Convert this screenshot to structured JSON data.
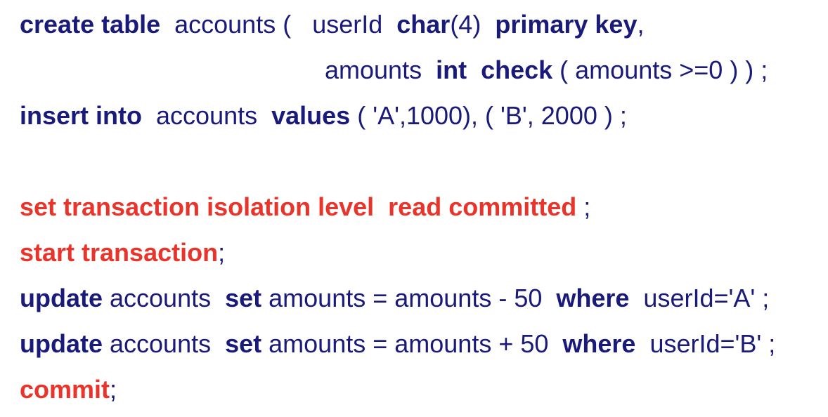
{
  "colors": {
    "text": "#1a1a7a",
    "highlight": "#e8342a",
    "background": "#ffffff"
  },
  "line1": {
    "kw_create_table": "create table",
    "t1": "  accounts (   userId  ",
    "kw_char": "char",
    "t2": "(4)  ",
    "kw_primary_key": "primary key",
    "t3": ","
  },
  "line2": {
    "t1": "amounts  ",
    "kw_int": "int",
    "t2": "  ",
    "kw_check": "check",
    "t3": " ( amounts >=0 ) ) ;"
  },
  "line3": {
    "kw_insert_into": "insert into",
    "t1": "  accounts  ",
    "kw_values": "values",
    "t2": " ( 'A',1000), ( 'B', 2000 ) ;"
  },
  "line4": {
    "red_set_isolation": "set transaction isolation level  read committed",
    "t1": " ;"
  },
  "line5": {
    "red_start_transaction": "start transaction",
    "t1": ";"
  },
  "line6": {
    "kw_update": "update",
    "t1": " accounts  ",
    "kw_set": "set",
    "t2": " amounts = amounts - 50  ",
    "kw_where": "where",
    "t3": "  userId='A' ;"
  },
  "line7": {
    "kw_update": "update",
    "t1": " accounts  ",
    "kw_set": "set",
    "t2": " amounts = amounts + 50  ",
    "kw_where": "where",
    "t3": "  userId='B' ;"
  },
  "line8": {
    "red_commit": "commit",
    "t1": ";"
  }
}
